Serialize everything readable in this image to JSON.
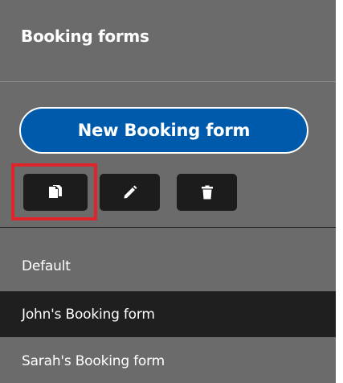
{
  "panel": {
    "title": "Booking forms",
    "new_button_label": "New Booking form"
  },
  "toolbar": {
    "buttons": [
      {
        "name": "copy",
        "icon": "copy-icon",
        "highlighted": true
      },
      {
        "name": "edit",
        "icon": "pencil-icon"
      },
      {
        "name": "delete",
        "icon": "trash-icon"
      }
    ]
  },
  "forms": {
    "items": [
      {
        "label": "Default",
        "selected": false
      },
      {
        "label": "John's Booking form",
        "selected": true
      },
      {
        "label": "Sarah's Booking form",
        "selected": false
      }
    ]
  },
  "colors": {
    "panel_bg": "#6b6b6b",
    "accent": "#005aab",
    "selected_bg": "#1f1f1f",
    "highlight": "#e0242b"
  }
}
